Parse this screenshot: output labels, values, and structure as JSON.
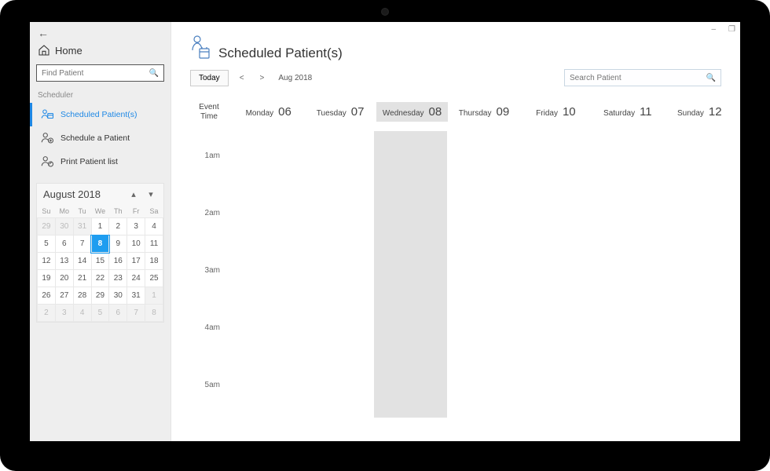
{
  "window": {
    "minimize": "–",
    "restore": "❐"
  },
  "sidebar": {
    "home": "Home",
    "find_placeholder": "Find Patient",
    "section": "Scheduler",
    "items": [
      {
        "label": "Scheduled Patient(s)"
      },
      {
        "label": "Schedule a Patient"
      },
      {
        "label": "Print Patient list"
      }
    ]
  },
  "minical": {
    "title": "August 2018",
    "dow": [
      "Su",
      "Mo",
      "Tu",
      "We",
      "Th",
      "Fr",
      "Sa"
    ],
    "weeks": [
      [
        {
          "n": "29",
          "dim": true
        },
        {
          "n": "30",
          "dim": true
        },
        {
          "n": "31",
          "dim": true
        },
        {
          "n": "1"
        },
        {
          "n": "2"
        },
        {
          "n": "3"
        },
        {
          "n": "4"
        }
      ],
      [
        {
          "n": "5"
        },
        {
          "n": "6"
        },
        {
          "n": "7"
        },
        {
          "n": "8",
          "sel": true
        },
        {
          "n": "9"
        },
        {
          "n": "10"
        },
        {
          "n": "11"
        }
      ],
      [
        {
          "n": "12"
        },
        {
          "n": "13"
        },
        {
          "n": "14"
        },
        {
          "n": "15"
        },
        {
          "n": "16"
        },
        {
          "n": "17"
        },
        {
          "n": "18"
        }
      ],
      [
        {
          "n": "19"
        },
        {
          "n": "20"
        },
        {
          "n": "21"
        },
        {
          "n": "22"
        },
        {
          "n": "23"
        },
        {
          "n": "24"
        },
        {
          "n": "25"
        }
      ],
      [
        {
          "n": "26"
        },
        {
          "n": "27"
        },
        {
          "n": "28"
        },
        {
          "n": "29"
        },
        {
          "n": "30"
        },
        {
          "n": "31"
        },
        {
          "n": "1",
          "dim": true
        }
      ],
      [
        {
          "n": "2",
          "dim": true
        },
        {
          "n": "3",
          "dim": true
        },
        {
          "n": "4",
          "dim": true
        },
        {
          "n": "5",
          "dim": true
        },
        {
          "n": "6",
          "dim": true
        },
        {
          "n": "7",
          "dim": true
        },
        {
          "n": "8",
          "dim": true
        }
      ]
    ]
  },
  "main": {
    "title": "Scheduled Patient(s)",
    "today_btn": "Today",
    "month": "Aug 2018",
    "search_placeholder": "Search Patient",
    "event_time": "Event Time",
    "days": [
      {
        "name": "Monday",
        "num": "06"
      },
      {
        "name": "Tuesday",
        "num": "07"
      },
      {
        "name": "Wednesday",
        "num": "08",
        "today": true
      },
      {
        "name": "Thursday",
        "num": "09"
      },
      {
        "name": "Friday",
        "num": "10"
      },
      {
        "name": "Saturday",
        "num": "11"
      },
      {
        "name": "Sunday",
        "num": "12"
      }
    ],
    "hours": [
      "1am",
      "2am",
      "3am",
      "4am",
      "5am"
    ]
  }
}
